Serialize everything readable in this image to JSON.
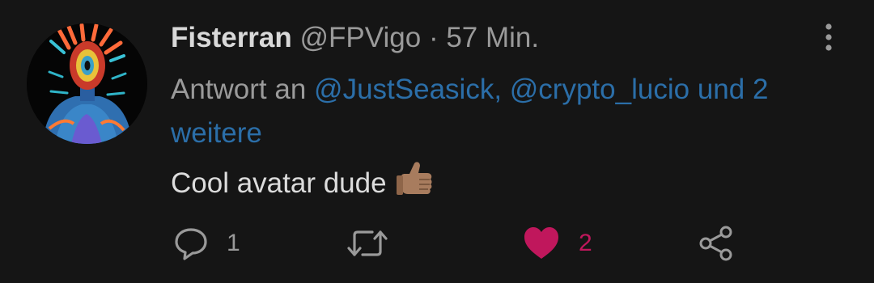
{
  "tweet": {
    "display_name": "Fisterran",
    "handle": "@FPVigo",
    "separator": "·",
    "time": "57 Min.",
    "reply_prefix": "Antwort an",
    "mention_1": "@JustSeasick,",
    "mention_2": "@crypto_lucio",
    "mention_and": "und",
    "mention_others": "2 weitere",
    "body_text": "Cool avatar dude",
    "body_emoji": "thumbs-up-medium-skin"
  },
  "actions": {
    "reply_icon": "reply-icon",
    "reply_count": "1",
    "retweet_icon": "retweet-icon",
    "like_icon": "heart-filled-icon",
    "like_count": "2",
    "share_icon": "share-icon"
  },
  "colors": {
    "background": "#151515",
    "name": "#d9d9d9",
    "secondary": "#9a9a9a",
    "link": "#2b6ea8",
    "like": "#c0175c"
  }
}
